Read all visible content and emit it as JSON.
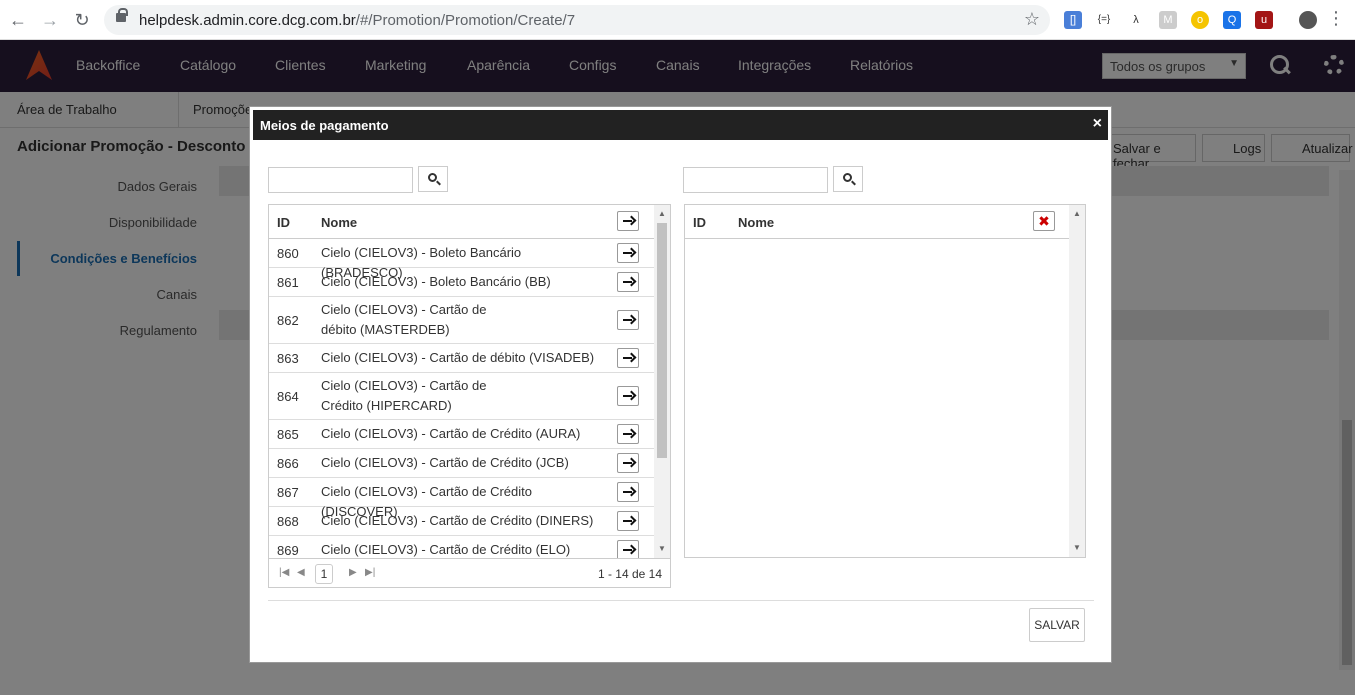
{
  "browser": {
    "url_host": "helpdesk.admin.core.dcg.com.br",
    "url_path": "/#/Promotion/Promotion/Create/7"
  },
  "topnav": {
    "items": [
      "Backoffice",
      "Catálogo",
      "Clientes",
      "Marketing",
      "Aparência",
      "Configs",
      "Canais",
      "Integrações",
      "Relatórios"
    ],
    "group_select": "Todos os grupos"
  },
  "tabs": [
    "Área de Trabalho",
    "Promoçõe"
  ],
  "page": {
    "title": "Adicionar Promoção - Desconto em",
    "buttons": [
      "Salvar e fechar",
      "Logs",
      "Atualizar"
    ]
  },
  "sidebar": {
    "items": [
      "Dados Gerais",
      "Disponibilidade",
      "Condições e Benefícios",
      "Canais",
      "Regulamento"
    ]
  },
  "modal": {
    "title": "Meios de pagamento",
    "close": "×",
    "left_grid": {
      "headers": {
        "id": "ID",
        "name": "Nome"
      },
      "rows": [
        {
          "id": "860",
          "name": "Cielo (CIELOV3) - Boleto Bancário (BRADESCO)"
        },
        {
          "id": "861",
          "name": "Cielo (CIELOV3) - Boleto Bancário (BB)"
        },
        {
          "id": "862",
          "name": "Cielo (CIELOV3) - Cartão de débito (MASTERDEB)"
        },
        {
          "id": "863",
          "name": "Cielo (CIELOV3) - Cartão de débito (VISADEB)"
        },
        {
          "id": "864",
          "name": "Cielo (CIELOV3) - Cartão de Crédito (HIPERCARD)"
        },
        {
          "id": "865",
          "name": "Cielo (CIELOV3) - Cartão de Crédito (AURA)"
        },
        {
          "id": "866",
          "name": "Cielo (CIELOV3) - Cartão de Crédito (JCB)"
        },
        {
          "id": "867",
          "name": "Cielo (CIELOV3) - Cartão de Crédito (DISCOVER)"
        },
        {
          "id": "868",
          "name": "Cielo (CIELOV3) - Cartão de Crédito (DINERS)"
        },
        {
          "id": "869",
          "name": "Cielo (CIELOV3) - Cartão de Crédito (ELO)"
        }
      ],
      "pager": {
        "current_page": "1",
        "info": "1 - 14 de 14"
      }
    },
    "right_grid": {
      "headers": {
        "id": "ID",
        "name": "Nome"
      },
      "clear_icon": "✖"
    },
    "save_label": "SALVAR"
  }
}
